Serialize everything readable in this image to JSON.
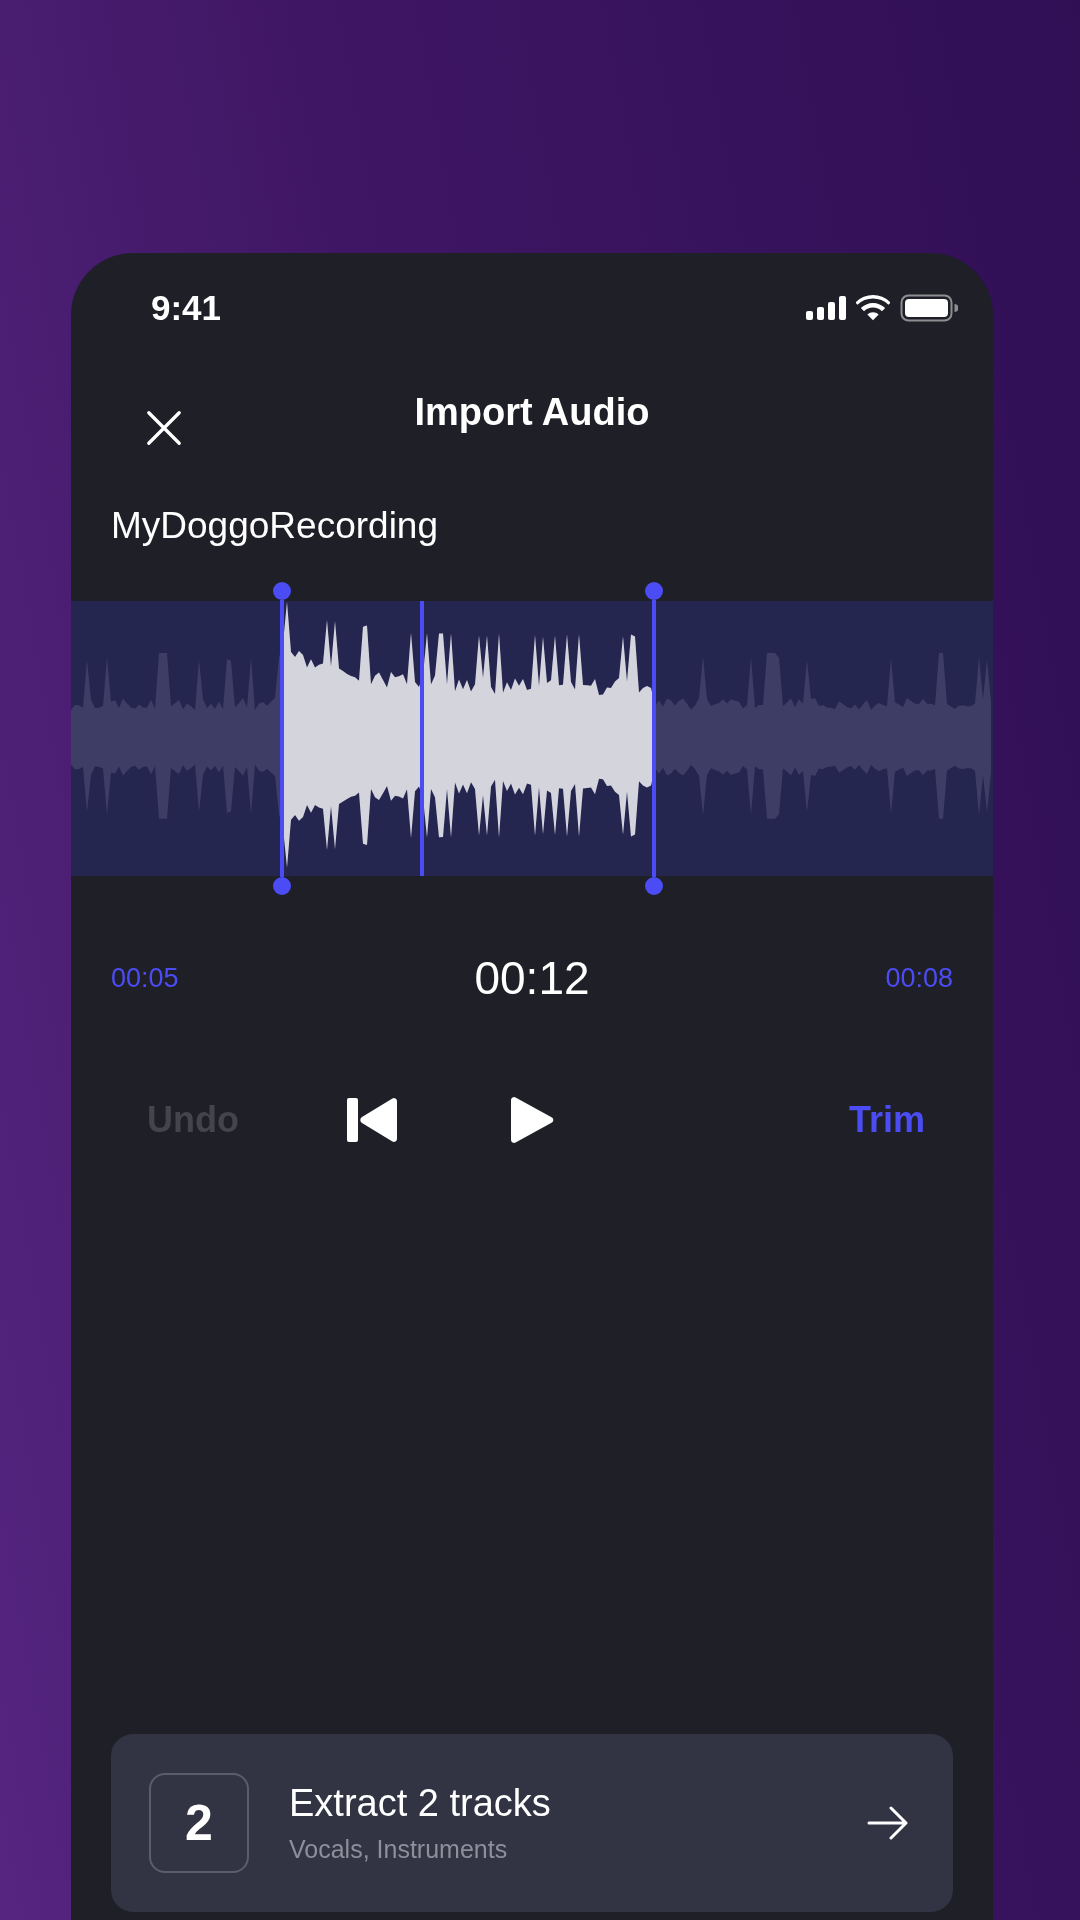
{
  "status_bar": {
    "time": "9:41"
  },
  "header": {
    "title": "Import Audio"
  },
  "file_name": "MyDoggoRecording",
  "times": {
    "start": "00:05",
    "current": "00:12",
    "end": "00:08"
  },
  "controls": {
    "undo": {
      "label": "Undo",
      "disabled": true
    },
    "trim": {
      "label": "Trim",
      "disabled": false
    }
  },
  "options": [
    {
      "number": "2",
      "title": "Extract 2 tracks",
      "subtitle": "Vocals, Instruments"
    }
  ]
}
